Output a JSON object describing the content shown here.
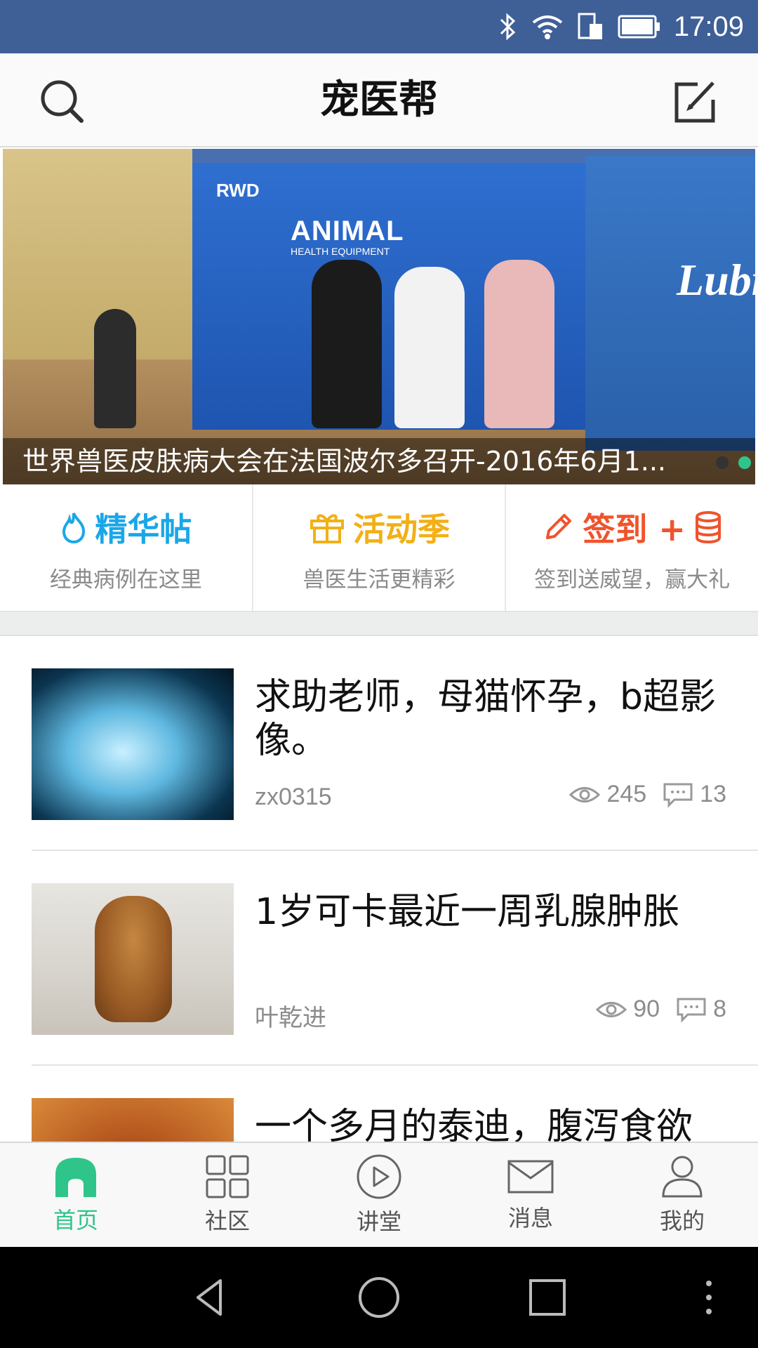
{
  "status_bar": {
    "time": "17:09"
  },
  "header": {
    "title": "宠医帮"
  },
  "banner": {
    "caption": "世界兽医皮肤病大会在法国波尔多召开-2016年6月1...",
    "sign_logo": "RWD",
    "sign_brand": "ANIMAL",
    "sign_brand_sub": "HEALTH EQUIPMENT",
    "sign_right": "Lubr"
  },
  "quick_entries": [
    {
      "title": "精华帖",
      "subtitle": "经典病例在这里",
      "color": "#1aa7e8",
      "icon": "flame-icon"
    },
    {
      "title": "活动季",
      "subtitle": "兽医生活更精彩",
      "color": "#f2b015",
      "icon": "gift-icon"
    },
    {
      "title": "签到 +",
      "subtitle": "签到送威望，赢大礼",
      "color": "#f0532c",
      "icon": "pencil-icon"
    }
  ],
  "posts": [
    {
      "title": "求助老师，母猫怀孕，b超影像。",
      "author": "zx0315",
      "views": "245",
      "comments": "13"
    },
    {
      "title": "1岁可卡最近一周乳腺肿胀",
      "author": "叶乾进",
      "views": "90",
      "comments": "8"
    },
    {
      "title": "一个多月的泰迪，腹泻食欲"
    }
  ],
  "tabs": [
    {
      "label": "首页",
      "icon": "home-icon",
      "active": true
    },
    {
      "label": "社区",
      "icon": "grid-icon",
      "active": false
    },
    {
      "label": "讲堂",
      "icon": "play-icon",
      "active": false
    },
    {
      "label": "消息",
      "icon": "mail-icon",
      "active": false
    },
    {
      "label": "我的",
      "icon": "person-icon",
      "active": false
    }
  ],
  "colors": {
    "accent": "#2fc58a",
    "status_bar": "#3f5f97"
  }
}
